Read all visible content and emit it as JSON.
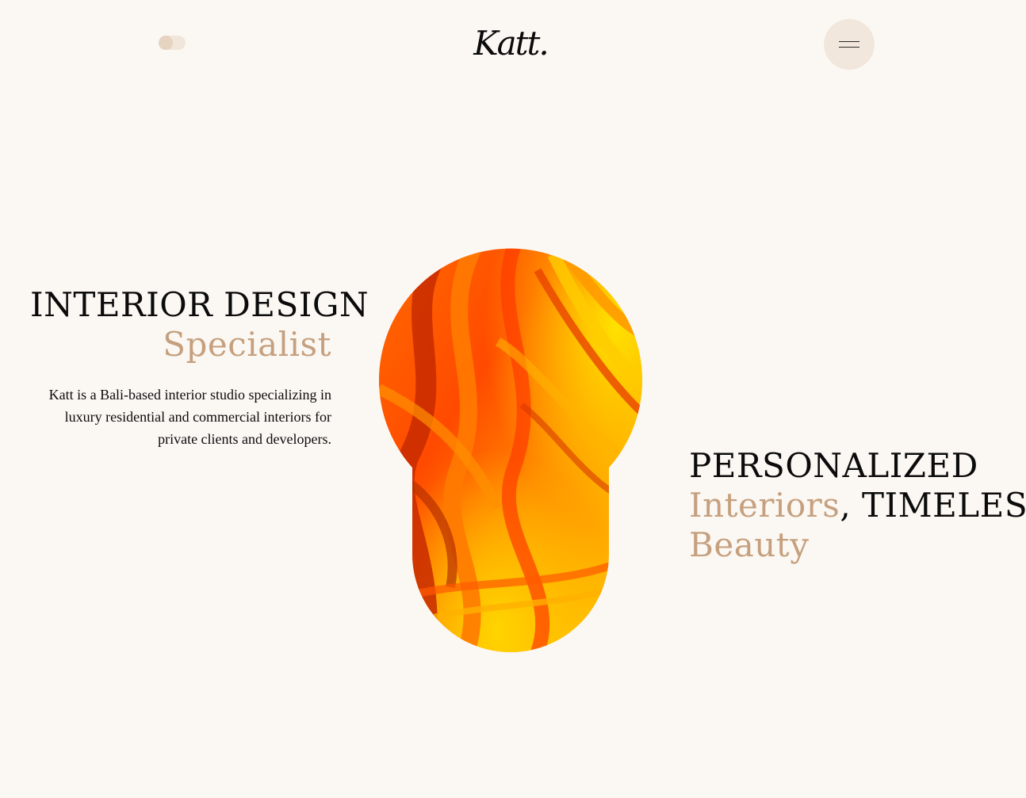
{
  "header": {
    "logo": "Katt.",
    "theme_toggle_label": "theme-toggle",
    "menu_icon": "hamburger-menu-icon"
  },
  "hero": {
    "left_title_line1": "INTERIOR DESIGN",
    "left_title_line2": "Specialist",
    "description": "Katt is a Bali-based interior studio specializing in luxury residential and commercial interiors for private clients and developers.",
    "right_title_line1": "PERSONALIZED",
    "right_title_accent": "Interiors",
    "right_title_separator": ",",
    "right_title_line2_rest": " TIMELESS",
    "right_title_line3": "Beauty"
  },
  "colors": {
    "background": "#fbf8f4",
    "accent": "#c6a07e",
    "text": "#0b0b0b",
    "menu_button": "#f2e7dc",
    "toggle_track": "#f1e6da",
    "toggle_knob": "#e6d3c0"
  }
}
